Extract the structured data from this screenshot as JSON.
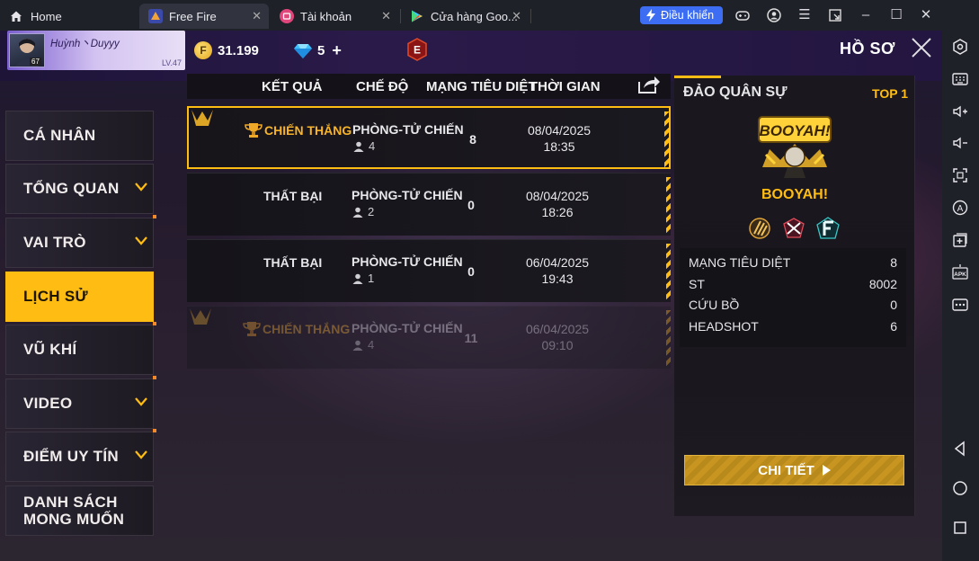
{
  "browser": {
    "tabs": [
      {
        "label": "Home"
      },
      {
        "label": "Free Fire"
      },
      {
        "label": "Tài khoản"
      },
      {
        "label": "Cửa hàng Goo..."
      }
    ],
    "control_label": "Điều khiển"
  },
  "header": {
    "player_name": "Huỳnh丶Duyyy",
    "avatar_level": "67",
    "profile_level": "LV.47",
    "gold": "31.199",
    "diamonds": "5",
    "title": "HỒ SƠ"
  },
  "nav": {
    "items": [
      {
        "label": "CÁ NHÂN",
        "active": false
      },
      {
        "label": "TỔNG QUAN",
        "active": false
      },
      {
        "label": "VAI TRÒ",
        "active": false
      },
      {
        "label": "LỊCH SỬ",
        "active": true
      },
      {
        "label": "VŨ KHÍ",
        "active": false
      },
      {
        "label": "VIDEO",
        "active": false
      },
      {
        "label": "ĐIỂM UY TÍN",
        "active": false
      },
      {
        "label": "DANH SÁCH",
        "label2": "MONG MUỐN",
        "active": false
      }
    ]
  },
  "table": {
    "headers": [
      "KẾT QUẢ",
      "CHẾ ĐỘ",
      "MẠNG TIÊU DIỆT",
      "THỜI GIAN"
    ],
    "rows": [
      {
        "result": "CHIẾN THẮNG",
        "mode": "PHÒNG-TỬ CHIẾN",
        "players": "4",
        "kills": "8",
        "date": "08/04/2025",
        "time": "18:35"
      },
      {
        "result": "THẤT BẠI",
        "mode": "PHÒNG-TỬ CHIẾN",
        "players": "2",
        "kills": "0",
        "date": "08/04/2025",
        "time": "18:26"
      },
      {
        "result": "THẤT BẠI",
        "mode": "PHÒNG-TỬ CHIẾN",
        "players": "1",
        "kills": "0",
        "date": "06/04/2025",
        "time": "19:43"
      },
      {
        "result": "CHIẾN THẮNG",
        "mode": "PHÒNG-TỬ CHIẾN",
        "players": "4",
        "kills": "11",
        "date": "06/04/2025",
        "time": "09:10"
      }
    ]
  },
  "detail": {
    "map": "ĐẢO QUÂN SỰ",
    "rank": "TOP 1",
    "booyah_art": "BOOYAH!",
    "booyah_label": "BOOYAH!",
    "stats": [
      {
        "label": "MẠNG TIÊU DIỆT",
        "value": "8"
      },
      {
        "label": "ST",
        "value": "8002"
      },
      {
        "label": "CỨU BỒ",
        "value": "0"
      },
      {
        "label": "HEADSHOT",
        "value": "6"
      }
    ],
    "button": "CHI TIẾT"
  },
  "colors": {
    "accent": "#ffbd13",
    "win": "#f7b42a",
    "control_button": "#3d6df2"
  }
}
